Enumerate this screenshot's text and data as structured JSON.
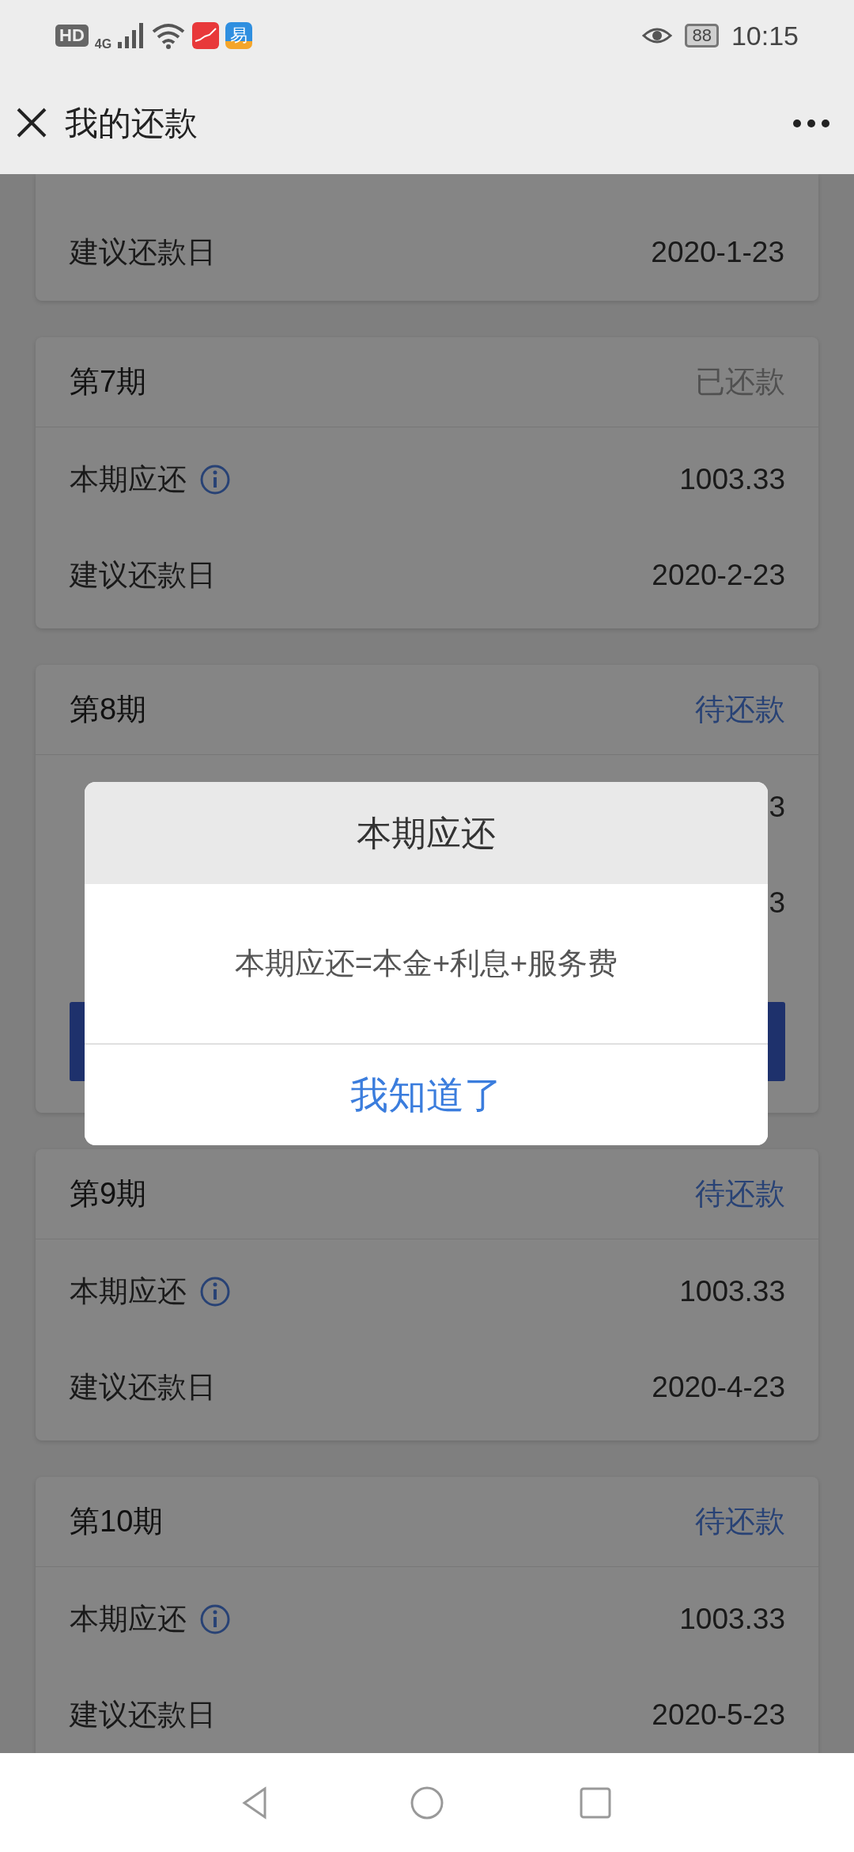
{
  "status_bar": {
    "hd": "HD",
    "network": "4G",
    "app_label": "易",
    "battery": "88",
    "time": "10:15"
  },
  "header": {
    "title": "我的还款"
  },
  "periods": [
    {
      "kind": "partial",
      "rows": [
        {
          "label": "建议还款日",
          "info": false,
          "value": "2020-1-23"
        }
      ]
    },
    {
      "kind": "card",
      "title": "第7期",
      "status": "已还款",
      "paid": true,
      "rows": [
        {
          "label": "本期应还",
          "info": true,
          "value": "1003.33"
        },
        {
          "label": "建议还款日",
          "info": false,
          "value": "2020-2-23"
        }
      ]
    },
    {
      "kind": "card",
      "title": "第8期",
      "status": "待还款",
      "paid": false,
      "pay_button": true,
      "rows": [
        {
          "value": "3"
        },
        {
          "value": "3"
        }
      ]
    },
    {
      "kind": "card",
      "title": "第9期",
      "status": "待还款",
      "paid": false,
      "rows": [
        {
          "label": "本期应还",
          "info": true,
          "value": "1003.33"
        },
        {
          "label": "建议还款日",
          "info": false,
          "value": "2020-4-23"
        }
      ]
    },
    {
      "kind": "card",
      "title": "第10期",
      "status": "待还款",
      "paid": false,
      "rows": [
        {
          "label": "本期应还",
          "info": true,
          "value": "1003.33"
        },
        {
          "label": "建议还款日",
          "info": false,
          "value": "2020-5-23"
        }
      ]
    }
  ],
  "dialog": {
    "title": "本期应还",
    "message": "本期应还=本金+利息+服务费",
    "button": "我知道了"
  }
}
